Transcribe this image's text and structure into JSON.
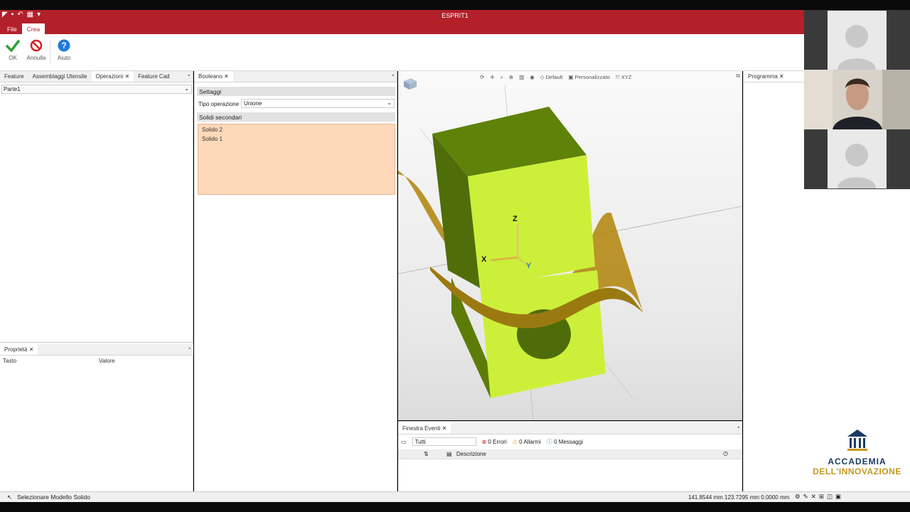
{
  "app": {
    "title": "ESPRIT1",
    "menu_tabs": [
      "File",
      "Crea"
    ]
  },
  "ribbon": {
    "ok_label": "OK",
    "annulla_label": "Annulla",
    "aiuto_label": "Aiuto"
  },
  "left_panel": {
    "tabs": [
      "Feature",
      "Assemblaggi Utensile",
      "Operazioni",
      "Feature Cad"
    ],
    "combo_value": "Parte1",
    "props_tab": "Proprietà",
    "props_col_key": "Tasto",
    "props_col_value": "Valore"
  },
  "booleano": {
    "tab": "Booleano",
    "settaggi": "Settaggi",
    "tipo_label": "Tipo operazione",
    "tipo_value": "Unione",
    "solidi_header": "Solidi secondari",
    "solidi": [
      "Solido 2",
      "Solido 1"
    ]
  },
  "viewport": {
    "toolbar": {
      "default": "Default",
      "personalizzato": "Personalizzato",
      "xyz": "XYZ"
    },
    "axes": {
      "x": "X",
      "y": "Y",
      "z": "Z"
    }
  },
  "eventi": {
    "tab": "Finestra Eventi",
    "filter": "Tutti",
    "errori": "0 Errori",
    "allarmi": "0 Allarmi",
    "messaggi": "0 Messaggi",
    "descrizione": "Descrizione"
  },
  "programma": {
    "tab": "Programma"
  },
  "status": {
    "message": "Selezionare Modello Solido",
    "coords": "141.8544 mm  123.7295 mm  0.0000 mm"
  },
  "logo": {
    "line1": "ACCADEMIA",
    "line2": "DELL'INNOVAZIONE"
  },
  "colors": {
    "titlebar": "#b4202a",
    "solid": "#ccf03a",
    "list_bg": "#fdd9b9"
  }
}
